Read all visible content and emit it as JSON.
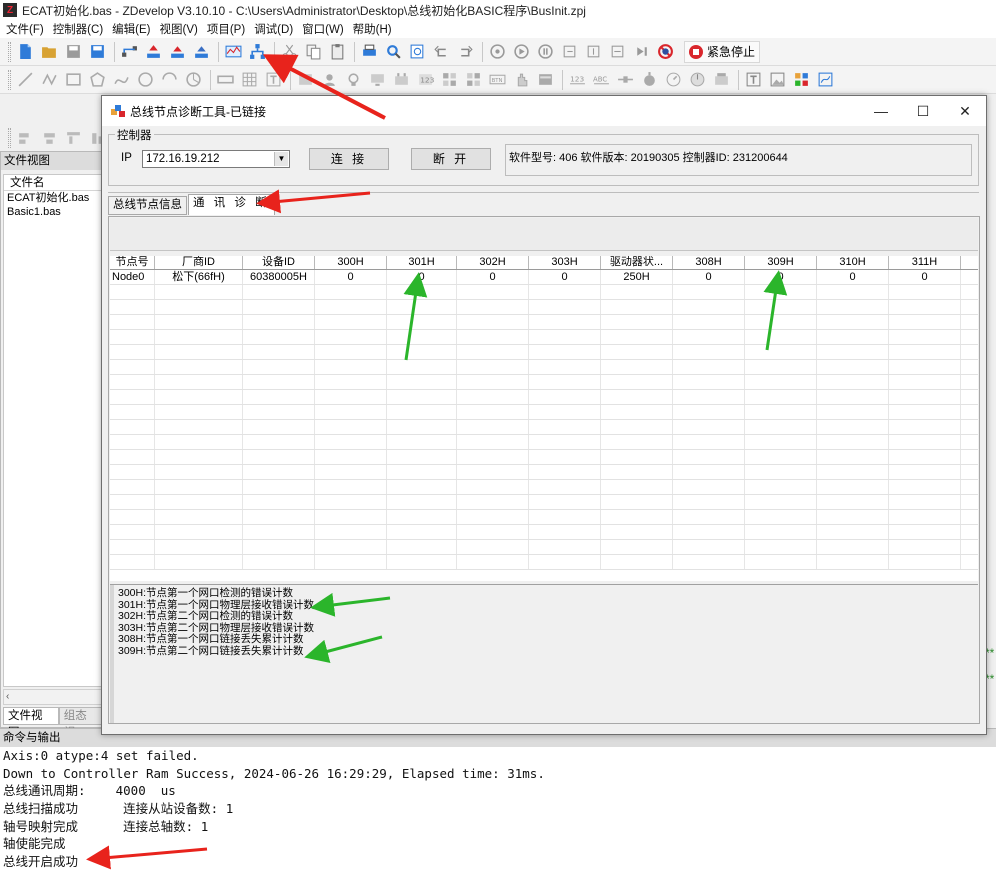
{
  "window": {
    "title": "ECAT初始化.bas - ZDevelop V3.10.10 - C:\\Users\\Administrator\\Desktop\\总线初始化BASIC程序\\BusInit.zpj",
    "icon_letter": "Z"
  },
  "menu": [
    "文件(F)",
    "控制器(C)",
    "编辑(E)",
    "视图(V)",
    "项目(P)",
    "调试(D)",
    "窗口(W)",
    "帮助(H)"
  ],
  "toolbar": {
    "estop_label": "紧急停止"
  },
  "file_view": {
    "title": "文件视图",
    "column_header": "文件名",
    "files": [
      "ECAT初始化.bas",
      "Basic1.bas"
    ],
    "tabs": [
      "文件视图",
      "组态视"
    ]
  },
  "dialog": {
    "title": "总线节点诊断工具-已链接",
    "controller_group": "控制器",
    "ip_label": "IP",
    "ip_value": "172.16.19.212",
    "connect_label": "连 接",
    "disconnect_label": "断 开",
    "info_text": "软件型号: 406 软件版本: 20190305 控制器ID: 231200644",
    "tabs": [
      "总线节点信息",
      "通 讯 诊 断"
    ],
    "grid": {
      "headers": [
        "节点号",
        "厂商ID",
        "设备ID",
        "300H",
        "301H",
        "302H",
        "303H",
        "驱动器状...",
        "308H",
        "309H",
        "310H",
        "311H"
      ],
      "rows": [
        [
          "Node0",
          "松下(66fH)",
          "60380005H",
          "0",
          "0",
          "0",
          "0",
          "250H",
          "0",
          "0",
          "0",
          "0"
        ]
      ]
    },
    "legend": [
      "300H:节点第一个网口检测的错误计数",
      "301H:节点第一个网口物理层接收错误计数",
      "302H:节点第二个网口检测的错误计数",
      "303H:节点第二个网口物理层接收错误计数",
      "308H:节点第一个网口链接丢失累计计数",
      "309H:节点第二个网口链接丢失累计计数"
    ]
  },
  "output": {
    "title": "命令与输出",
    "lines": [
      "Axis:0 atype:4 set failed.",
      "Down to Controller Ram Success, 2024-06-26 16:29:29, Elapsed time: 31ms.",
      "总线通讯周期:    4000  us",
      "总线扫描成功      连接从站设备数: 1",
      "轴号映射完成      连接总轴数: 1",
      "轴使能完成",
      "总线开启成功"
    ]
  },
  "colors": {
    "annotation_red": "#e8231c",
    "annotation_green": "#2bb52b",
    "estop_red": "#d9262c"
  }
}
